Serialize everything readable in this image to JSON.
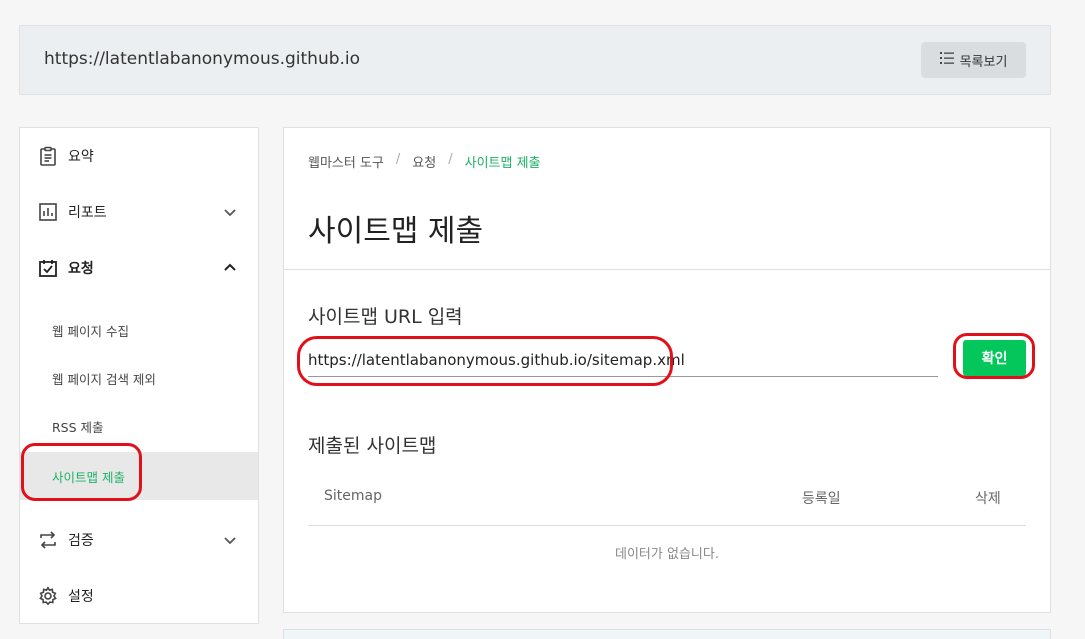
{
  "header": {
    "site_url": "https://latentlabanonymous.github.io",
    "list_button_label": "목록보기"
  },
  "sidebar": {
    "items": [
      {
        "label": "요약",
        "icon": "clipboard-icon"
      },
      {
        "label": "리포트",
        "icon": "report-chart-icon"
      },
      {
        "label": "요청",
        "icon": "request-check-icon"
      },
      {
        "label": "검증",
        "icon": "arrows-swap-icon"
      },
      {
        "label": "설정",
        "icon": "gear-icon"
      }
    ],
    "sub_items": [
      {
        "label": "웹 페이지 수집"
      },
      {
        "label": "웹 페이지 검색 제외"
      },
      {
        "label": "RSS 제출"
      },
      {
        "label": "사이트맵 제출"
      }
    ]
  },
  "breadcrumb": {
    "level1": "웹마스터 도구",
    "level2": "요청",
    "current": "사이트맵 제출",
    "separator": "/"
  },
  "main": {
    "title": "사이트맵 제출",
    "url_label": "사이트맵 URL 입력",
    "url_value": "https://latentlabanonymous.github.io/sitemap.xml",
    "confirm_label": "확인",
    "submitted_title": "제출된 사이트맵",
    "table": {
      "columns": [
        "Sitemap",
        "등록일",
        "삭제"
      ],
      "empty_message": "데이터가 없습니다."
    }
  },
  "colors": {
    "accent_green": "#03c75a",
    "active_text_green": "#1bb266",
    "annotation_red": "#e0111b"
  }
}
